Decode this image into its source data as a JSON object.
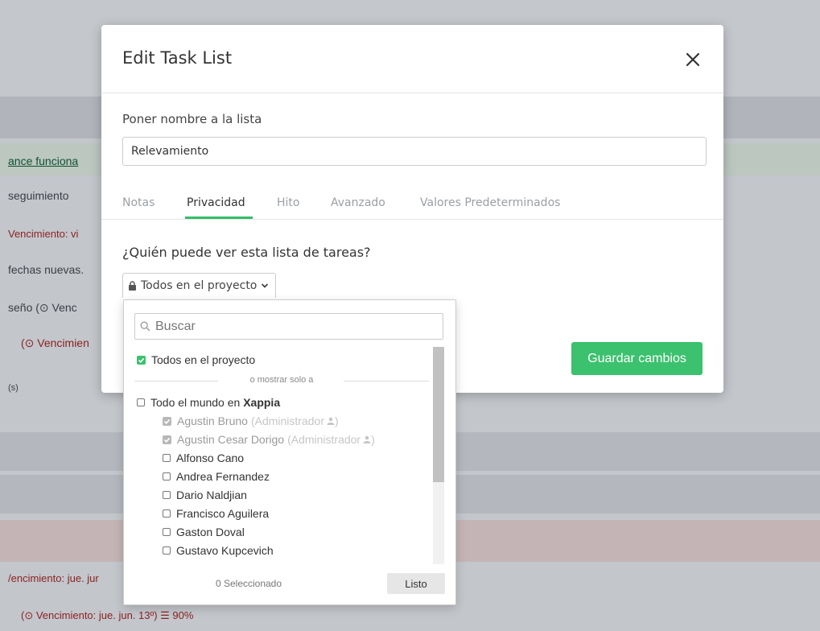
{
  "background": {
    "rows": [
      {
        "text": "ance funciona",
        "style": "link"
      },
      {
        "text": "seguimiento",
        "style": "normal"
      },
      {
        "text": "Vencimiento: vi",
        "style": "red"
      },
      {
        "text": "fechas nuevas.",
        "style": "normal"
      },
      {
        "text": "seño  (⊙ Venc",
        "style": "normal"
      },
      {
        "text": "(⊙ Vencimien",
        "style": "red"
      },
      {
        "text": "(s)",
        "style": "small"
      },
      {
        "text": "/encimiento: jue. jur",
        "style": "red"
      },
      {
        "text": "(⊙ Vencimiento: jue. jun. 13º)  ☰  90%",
        "style": "red"
      }
    ]
  },
  "modal": {
    "title": "Edit Task List",
    "name_label": "Poner nombre a la lista",
    "name_value": "Relevamiento",
    "tabs": [
      {
        "label": "Notas",
        "active": false
      },
      {
        "label": "Privacidad",
        "active": true
      },
      {
        "label": "Hito",
        "active": false
      },
      {
        "label": "Avanzado",
        "active": false
      },
      {
        "label": "Valores Predeterminados",
        "active": false
      }
    ],
    "question": "¿Quién puede ver esta lista de tareas?",
    "privacy_selected": "Todos en el proyecto",
    "save_label": "Guardar cambios"
  },
  "dropdown": {
    "search_placeholder": "Buscar",
    "all_project_label": "Todos en el proyecto",
    "divider_text": "o mostrar solo a",
    "everyone_prefix": "Todo el mundo en ",
    "company": "Xappia",
    "users": [
      {
        "name": "Agustin Bruno",
        "role": "(Administrador",
        "role_end": ")",
        "checked": true,
        "disabled": true
      },
      {
        "name": "Agustin Cesar Dorigo",
        "role": "(Administrador",
        "role_end": ")",
        "checked": true,
        "disabled": true
      },
      {
        "name": "Alfonso Cano",
        "checked": false
      },
      {
        "name": "Andrea Fernandez",
        "checked": false
      },
      {
        "name": "Dario Naldjian",
        "checked": false
      },
      {
        "name": "Francisco Aguilera",
        "checked": false
      },
      {
        "name": "Gaston Doval",
        "checked": false
      },
      {
        "name": "Gustavo Kupcevich",
        "checked": false
      }
    ],
    "selected_count": "0 Seleccionado",
    "done_label": "Listo"
  },
  "colors": {
    "accent_green": "#3cc16e",
    "overdue_red": "#8a2323"
  }
}
